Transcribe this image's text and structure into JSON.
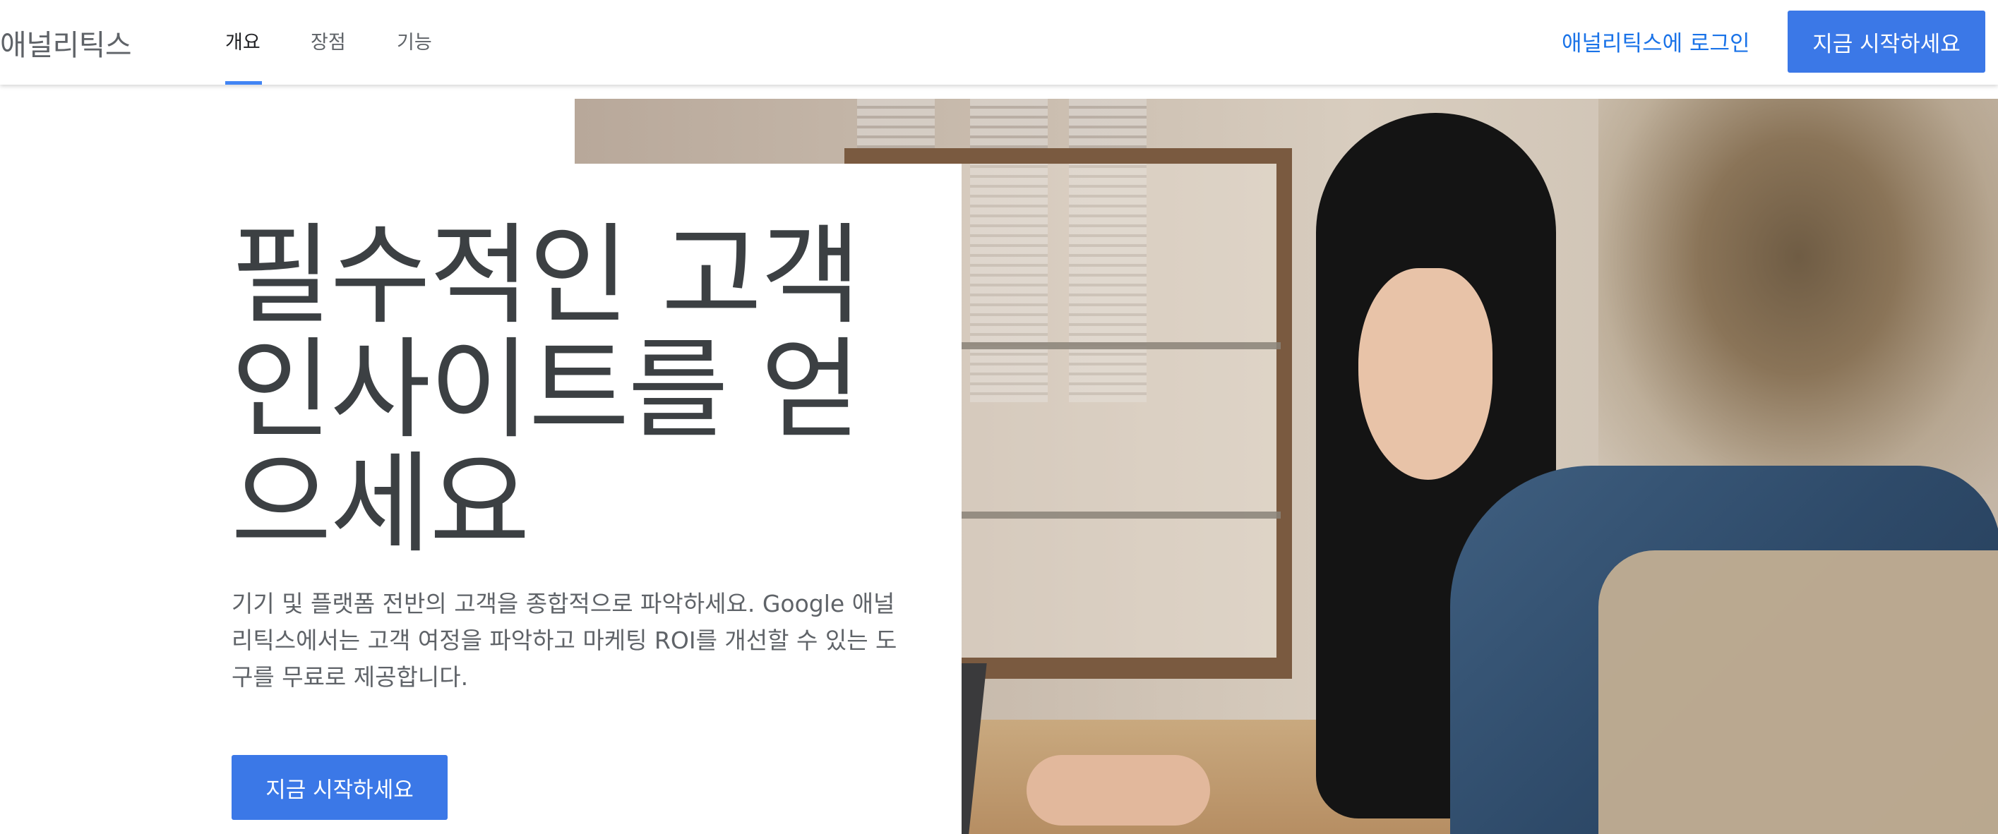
{
  "header": {
    "brand": "애널리틱스",
    "tabs": [
      {
        "label": "개요",
        "active": true
      },
      {
        "label": "장점",
        "active": false
      },
      {
        "label": "기능",
        "active": false
      }
    ],
    "login_label": "애널리틱스에 로그인",
    "cta_label": "지금 시작하세요"
  },
  "hero": {
    "title": "필수적인 고객 인사이트를 얻으세요",
    "description": "기기 및 플랫폼 전반의 고객을 종합적으로 파악하세요. Google 애널리틱스에서는 고객 여정을 파악하고 마케팅 ROI를 개선할 수 있는 도구를 무료로 제공합니다.",
    "cta_label": "지금 시작하세요"
  },
  "colors": {
    "accent": "#3b78e7",
    "link": "#1a73e8",
    "heading": "#3c4043",
    "body_text": "#5f6368"
  }
}
